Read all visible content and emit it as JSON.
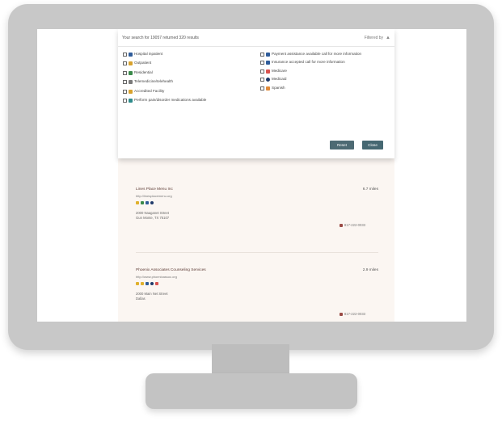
{
  "results": {
    "summary": "Your search for 19057 returned 320 results",
    "filtered_by": "Filtered by"
  },
  "filters": {
    "left": [
      {
        "label": "Hospital inpatient",
        "icon": "hospital-icon"
      },
      {
        "label": "Outpatient",
        "icon": "outpatient-icon"
      },
      {
        "label": "Residential",
        "icon": "residential-icon"
      },
      {
        "label": "Telemedicine/telehealth",
        "icon": "telehealth-icon"
      },
      {
        "label": "Accredited Facility",
        "icon": "accredited-icon"
      },
      {
        "label": "Perform pain/disorder medications available",
        "icon": "medication-icon"
      }
    ],
    "right": [
      {
        "label": "Payment assistance available call for more information",
        "icon": "payment-icon"
      },
      {
        "label": "Insurance accepted call for more information",
        "icon": "insurance-icon"
      },
      {
        "label": "Medicare",
        "icon": "medicare-icon"
      },
      {
        "label": "Medicaid",
        "icon": "medicaid-icon"
      },
      {
        "label": "Spanish",
        "icon": "spanish-icon"
      }
    ],
    "reset_label": "Reset",
    "close_label": "Close"
  },
  "listings": [
    {
      "name": "Lines Place Menu Inc",
      "url": "http://linesplacemenu.org",
      "miles": "6.7 miles",
      "address_line1": "2000 Naaganet Street",
      "address_line2": "Gun Monte, TX 75107",
      "phone": "817-222-0033"
    },
    {
      "name": "Phoenix Associates Counseling Services",
      "url": "http://www.phoenixassoc.org",
      "miles": "2.9 miles",
      "address_line1": "2000 Main Net Street",
      "address_line2": "Dallas",
      "phone": "817-222-0033"
    }
  ],
  "colors": {
    "monitor": "#c8c8c8",
    "button": "#4d6a73",
    "listing_name": "#5d3b35",
    "page_bg": "#fbf6f2"
  }
}
